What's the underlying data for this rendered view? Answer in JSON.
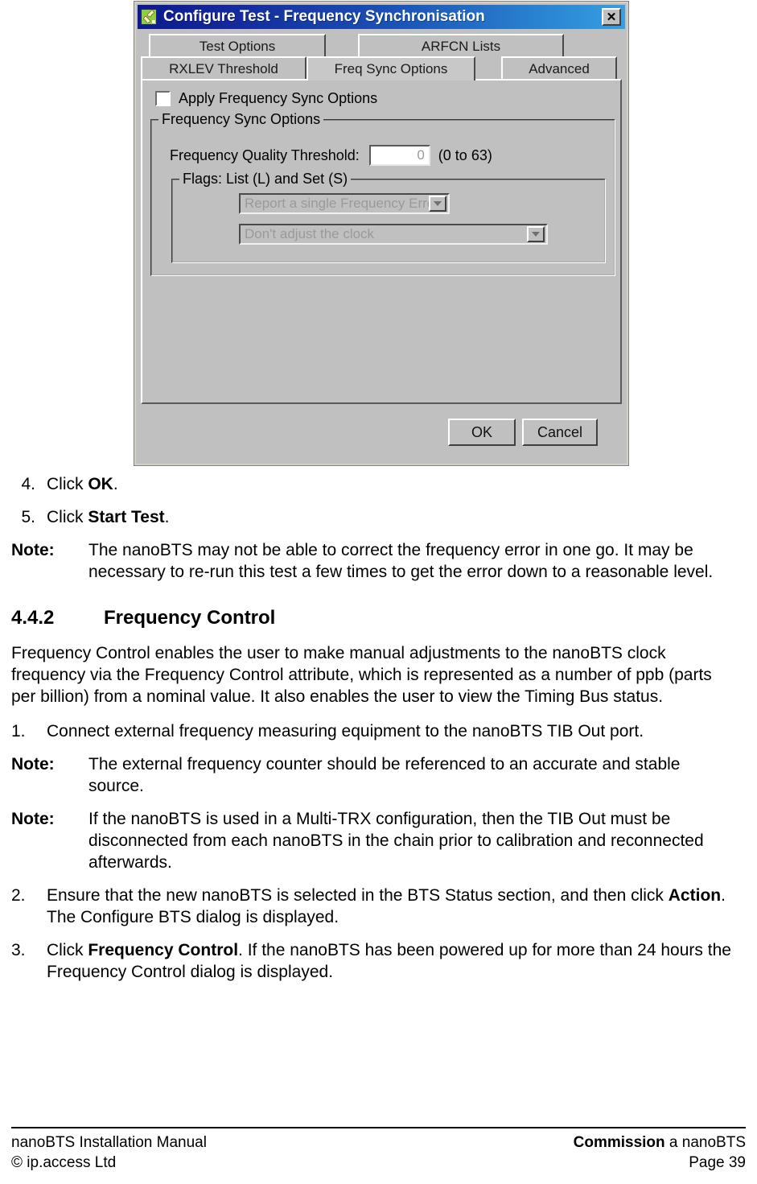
{
  "dialog": {
    "title": "Configure Test - Frequency Synchronisation",
    "icon": "bone-icon",
    "close_label": "✕",
    "tabs_row1": [
      {
        "label": "Test Options",
        "selected": false
      },
      {
        "label": "ARFCN Lists",
        "selected": false
      }
    ],
    "tabs_row2": [
      {
        "label": "RXLEV Threshold",
        "selected": false
      },
      {
        "label": "Freq Sync Options",
        "selected": true
      },
      {
        "label": "Advanced",
        "selected": false
      }
    ],
    "apply_checkbox": {
      "label": "Apply Frequency Sync Options",
      "checked": false
    },
    "group_outer_title": "Frequency Sync Options",
    "threshold": {
      "label": "Frequency Quality Threshold:",
      "value": "0",
      "range_hint": "(0 to 63)"
    },
    "group_inner_title": "Flags: List (L) and Set (S)",
    "combo1": {
      "value": "Report a single Frequency Error",
      "disabled": true
    },
    "combo2": {
      "value": "Don't adjust the clock",
      "disabled": true
    },
    "ok_label": "OK",
    "cancel_label": "Cancel"
  },
  "doc": {
    "step4": {
      "num": "4.",
      "text_pre": "Click ",
      "bold": "OK",
      "text_post": "."
    },
    "step5": {
      "num": "5.",
      "text_pre": "Click ",
      "bold": "Start Test",
      "text_post": "."
    },
    "note1": {
      "label": "Note:",
      "text": "The nanoBTS may not be able to correct the frequency error in one go. It may be necessary to re-run this test a few times to get the error down to a reasonable level."
    },
    "section": {
      "number": "4.4.2",
      "title": "Frequency Control"
    },
    "paragraph": "Frequency Control enables the user to make manual adjustments to the nanoBTS clock frequency via the Frequency Control attribute, which is represented as a number of ppb (parts per billion) from a nominal value. It also enables the user to view the Timing Bus status.",
    "step1": {
      "num": "1.",
      "text": "Connect external frequency measuring equipment to the nanoBTS TIB Out port."
    },
    "note2": {
      "label": "Note:",
      "text": "The external frequency counter should be referenced to an accurate and stable source."
    },
    "note3": {
      "label": "Note:",
      "text": "If the nanoBTS is used in a Multi-TRX configuration, then the TIB Out must be disconnected from each nanoBTS in the chain prior to calibration and reconnected afterwards."
    },
    "step2": {
      "num": "2.",
      "text_pre": "Ensure that the new nanoBTS is selected in the BTS Status section, and then click ",
      "bold": "Action",
      "text_post": ". The Configure BTS dialog is displayed."
    },
    "step3": {
      "num": "3.",
      "text_pre": "Click ",
      "bold": "Frequency Control",
      "text_post": ". If the nanoBTS has been powered up for more than 24 hours the Frequency Control dialog is displayed."
    }
  },
  "footer": {
    "left_top": "nanoBTS Installation Manual",
    "left_bottom": "© ip.access Ltd",
    "right_top_bold": "Commission",
    "right_top_rest": " a nanoBTS",
    "right_bottom": "Page 39"
  }
}
